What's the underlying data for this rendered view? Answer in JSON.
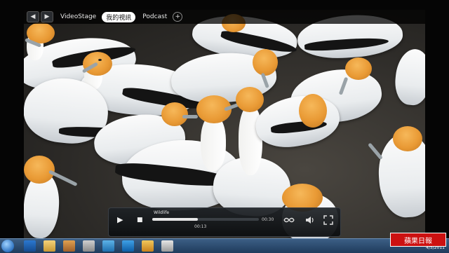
{
  "nav": {
    "back_glyph": "◀",
    "forward_glyph": "▶",
    "crumbs": [
      {
        "label": "VideoStage"
      },
      {
        "label": "我的視訊"
      },
      {
        "label": "Podcast"
      }
    ],
    "add_glyph": "+"
  },
  "player": {
    "title": "Wildlife",
    "elapsed": "00:13",
    "duration": "00:30",
    "progress_fraction": 0.43,
    "play_glyph": "▶",
    "stop_glyph": "■"
  },
  "taskbar": {
    "date": "4/5/2011"
  },
  "watermark": {
    "text": "蘋果日報"
  },
  "colors": {
    "head_orange": "#e99a35",
    "wing_black": "#141414",
    "bezel": "#050505",
    "watermark_red": "#cc1111"
  }
}
